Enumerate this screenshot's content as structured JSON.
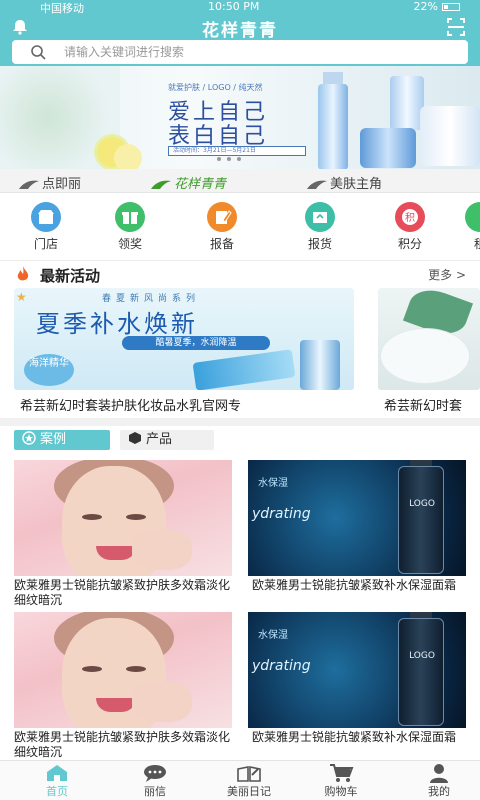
{
  "status_bar": {
    "carrier": "中国移动",
    "time": "10:50 PM",
    "battery": "22%"
  },
  "header": {
    "title": "花样青青"
  },
  "search": {
    "placeholder": "请输入关键词进行搜索"
  },
  "banner": {
    "tagline": "就爱护肤 / LOGO / 纯天然",
    "line1": "爱上自己",
    "line2": "表白自己",
    "date": "活动时间：3月21日—5月21日"
  },
  "brand_tabs": [
    {
      "label": "点即丽"
    },
    {
      "label": "花样青青"
    },
    {
      "label": "美肤主角"
    }
  ],
  "quick_icons": [
    {
      "label": "门店",
      "icon": "store-icon",
      "color": "#4aa3e0"
    },
    {
      "label": "领奖",
      "icon": "gift-icon",
      "color": "#3fbf6a"
    },
    {
      "label": "报备",
      "icon": "edit-icon",
      "color": "#f08a2a"
    },
    {
      "label": "报货",
      "icon": "box-icon",
      "color": "#3dbfa7"
    },
    {
      "label": "积分",
      "icon": "points-icon",
      "color": "#e74c5a"
    },
    {
      "label": "租",
      "icon": "rent-icon",
      "color": "#3fbf6a"
    }
  ],
  "activity": {
    "title": "最新活动",
    "more": "更多 >",
    "promo": {
      "sub": "春夏新风尚系列",
      "headline": "夏季补水焕新",
      "ribbon": "酷暑夏季，水润降温",
      "seal": "海洋精华"
    },
    "captions": [
      "希芸新幻时套装护肤化妆品水乳官网专",
      "希芸新幻时套"
    ]
  },
  "content_tabs": {
    "case": "案例",
    "product": "产品"
  },
  "cards": [
    {
      "caption": "欧莱雅男士锐能抗皱紧致护肤多效霜淡化细纹暗沉"
    },
    {
      "caption": "欧莱雅男士锐能抗皱紧致补水保湿面霜",
      "text1": "水保湿",
      "text2": "ydrating",
      "logo": "LOGO"
    },
    {
      "caption": "欧莱雅男士锐能抗皱紧致护肤多效霜淡化细纹暗沉"
    },
    {
      "caption": "欧莱雅男士锐能抗皱紧致补水保湿面霜",
      "text1": "水保湿",
      "text2": "ydrating",
      "logo": "LOGO"
    }
  ],
  "tab_bar": [
    {
      "label": "首页",
      "icon": "home-icon",
      "active": true
    },
    {
      "label": "丽信",
      "icon": "chat-icon"
    },
    {
      "label": "美丽日记",
      "icon": "diary-icon"
    },
    {
      "label": "购物车",
      "icon": "cart-icon"
    },
    {
      "label": "我的",
      "icon": "user-icon"
    }
  ],
  "colors": {
    "accent": "#62c8cf",
    "active_brand": "#3f9c2a"
  }
}
